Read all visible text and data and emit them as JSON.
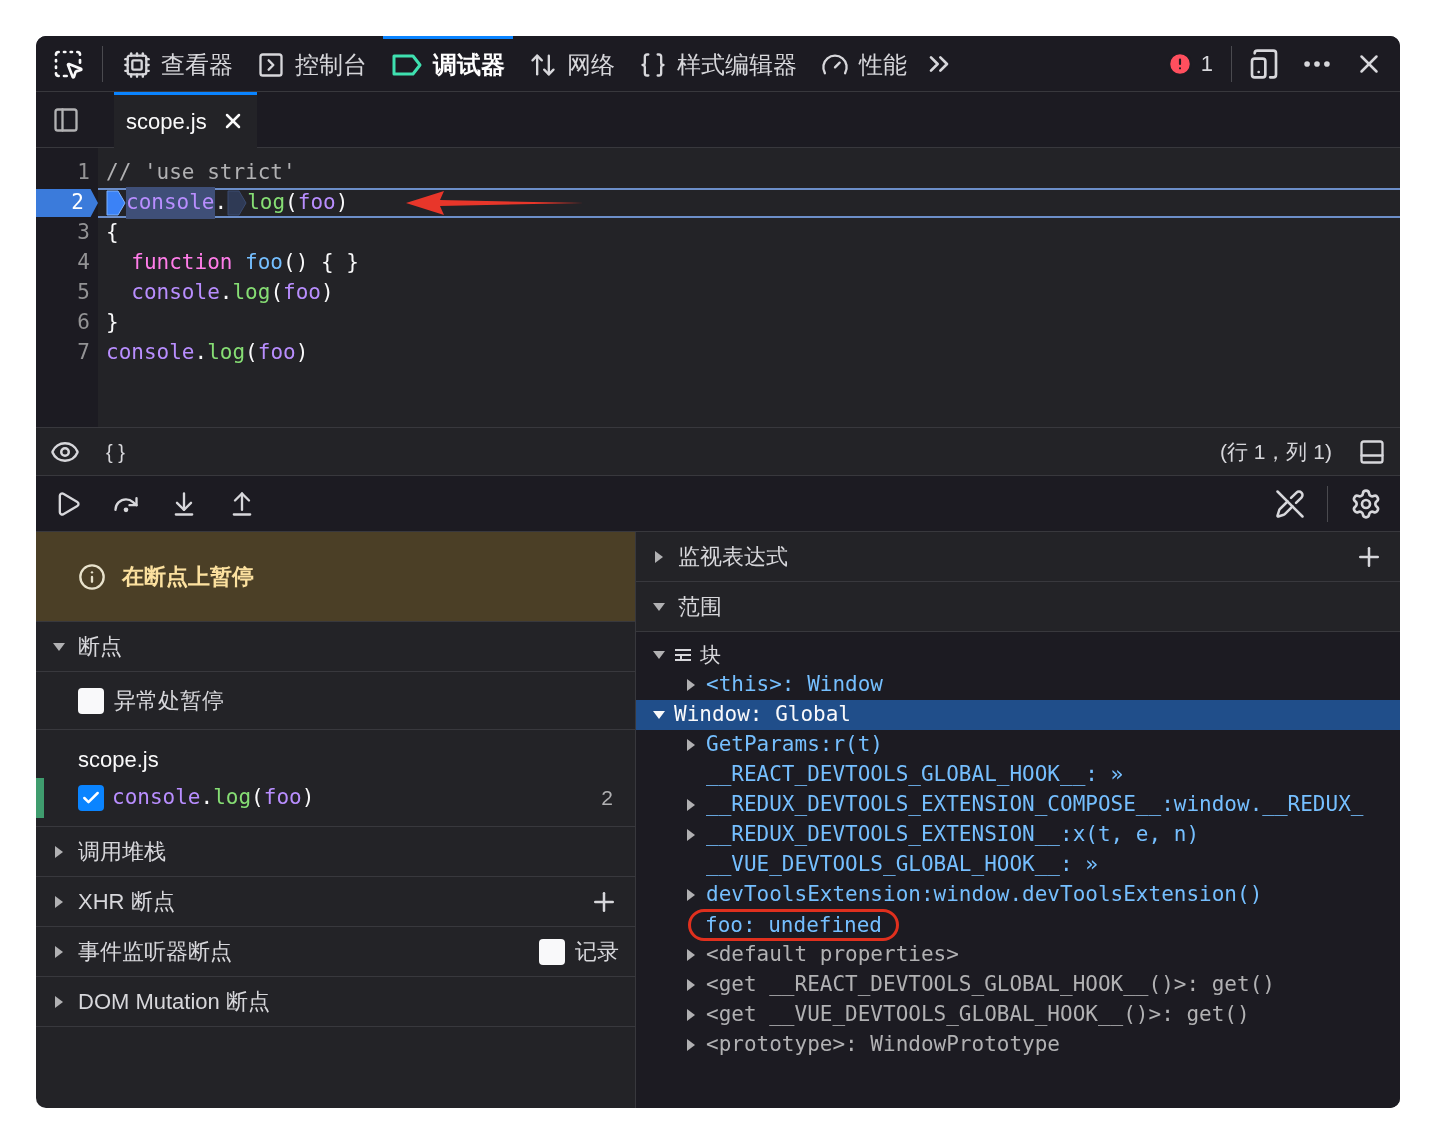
{
  "toolbar": {
    "tabs": [
      {
        "label": "查看器",
        "selected": false
      },
      {
        "label": "控制台",
        "selected": false
      },
      {
        "label": "调试器",
        "selected": true
      },
      {
        "label": "网络",
        "selected": false
      },
      {
        "label": "样式编辑器",
        "selected": false
      },
      {
        "label": "性能",
        "selected": false
      }
    ],
    "error_count": "1"
  },
  "source_tabs": [
    {
      "label": "scope.js",
      "selected": true
    }
  ],
  "code": [
    {
      "number": "1",
      "paused": false,
      "tokens": [
        {
          "text": "// 'use strict'",
          "kind": "comment"
        }
      ]
    },
    {
      "number": "2",
      "paused": true,
      "tokens": [
        {
          "text": "console",
          "kind": "object",
          "breakpoint_active": true,
          "selected": true
        },
        {
          "text": ".",
          "kind": "plain"
        },
        {
          "text": "log",
          "kind": "method",
          "breakpoint_active": false
        },
        {
          "text": "(",
          "kind": "plain"
        },
        {
          "text": "foo",
          "kind": "object"
        },
        {
          "text": ")",
          "kind": "plain"
        }
      ]
    },
    {
      "number": "3",
      "paused": false,
      "tokens": [
        {
          "text": "{",
          "kind": "plain"
        }
      ]
    },
    {
      "number": "4",
      "paused": false,
      "tokens": [
        {
          "text": "  function",
          "kind": "keyword"
        },
        {
          "text": " foo",
          "kind": "name"
        },
        {
          "text": "() { }",
          "kind": "plain"
        }
      ]
    },
    {
      "number": "5",
      "paused": false,
      "tokens": [
        {
          "text": "  console",
          "kind": "object"
        },
        {
          "text": ".",
          "kind": "plain"
        },
        {
          "text": "log",
          "kind": "method"
        },
        {
          "text": "(",
          "kind": "plain"
        },
        {
          "text": "foo",
          "kind": "object"
        },
        {
          "text": ")",
          "kind": "plain"
        }
      ]
    },
    {
      "number": "6",
      "paused": false,
      "tokens": [
        {
          "text": "}",
          "kind": "plain"
        }
      ]
    },
    {
      "number": "7",
      "paused": false,
      "tokens": [
        {
          "text": "console",
          "kind": "object"
        },
        {
          "text": ".",
          "kind": "plain"
        },
        {
          "text": "log",
          "kind": "method"
        },
        {
          "text": "(",
          "kind": "plain"
        },
        {
          "text": "foo",
          "kind": "object"
        },
        {
          "text": ")",
          "kind": "plain"
        }
      ]
    }
  ],
  "footer": {
    "prettify": "{ }",
    "position": "(行 1，列 1)"
  },
  "paused_message": "在断点上暂停",
  "left_sections": [
    {
      "title": "断点",
      "expanded": true,
      "kind": "breakpoints",
      "pause_on_exceptions": {
        "label": "异常处暂停",
        "checked": false
      },
      "files": [
        {
          "name": "scope.js",
          "breakpoints": [
            {
              "checked": true,
              "line": "2",
              "tokens": [
                {
                  "text": "console",
                  "kind": "object"
                },
                {
                  "text": ".",
                  "kind": "plain"
                },
                {
                  "text": "log",
                  "kind": "method"
                },
                {
                  "text": "(",
                  "kind": "plain"
                },
                {
                  "text": "foo",
                  "kind": "object"
                },
                {
                  "text": ")",
                  "kind": "plain"
                }
              ]
            }
          ]
        }
      ]
    },
    {
      "title": "调用堆栈",
      "expanded": false,
      "kind": "plain"
    },
    {
      "title": "XHR 断点",
      "expanded": false,
      "kind": "add"
    },
    {
      "title": "事件监听器断点",
      "expanded": false,
      "kind": "log",
      "log": {
        "label": "记录",
        "checked": false
      }
    },
    {
      "title": "DOM Mutation 断点",
      "expanded": false,
      "kind": "plain"
    }
  ],
  "right_sections": [
    {
      "title": "监视表达式",
      "expanded": false,
      "kind": "add"
    },
    {
      "title": "范围",
      "expanded": true,
      "kind": "plain"
    }
  ],
  "scopes": [
    {
      "text": "块",
      "kind": "block",
      "expanded": true,
      "selected": false,
      "children": [
        {
          "text": "<this>: Window",
          "kind": "own",
          "expandable": true
        }
      ]
    },
    {
      "text": "Window: Global",
      "kind": "scope",
      "expanded": true,
      "selected": true,
      "children": [
        {
          "text": "GetParams:r(t)",
          "kind": "own",
          "expandable": true
        },
        {
          "text": "__REACT_DEVTOOLS_GLOBAL_HOOK__: »",
          "kind": "own",
          "expandable": false
        },
        {
          "text": "__REDUX_DEVTOOLS_EXTENSION_COMPOSE__:window.__REDUX_",
          "kind": "own",
          "expandable": true
        },
        {
          "text": "__REDUX_DEVTOOLS_EXTENSION__:x(t, e, n)",
          "kind": "own",
          "expandable": true
        },
        {
          "text": "__VUE_DEVTOOLS_GLOBAL_HOOK__: »",
          "kind": "own",
          "expandable": false
        },
        {
          "text": "devToolsExtension:window.devToolsExtension()",
          "kind": "own",
          "expandable": true
        },
        {
          "text": "foo: undefined",
          "kind": "own",
          "expandable": false,
          "circled": true
        },
        {
          "text": "<default properties>",
          "kind": "meta",
          "expandable": true
        },
        {
          "text": "<get __REACT_DEVTOOLS_GLOBAL_HOOK__()>: get()",
          "kind": "meta",
          "expandable": true
        },
        {
          "text": "<get __VUE_DEVTOOLS_GLOBAL_HOOK__()>: get()",
          "kind": "meta",
          "expandable": true
        },
        {
          "text": "<prototype>: WindowPrototype",
          "kind": "meta",
          "expandable": true
        }
      ]
    }
  ]
}
